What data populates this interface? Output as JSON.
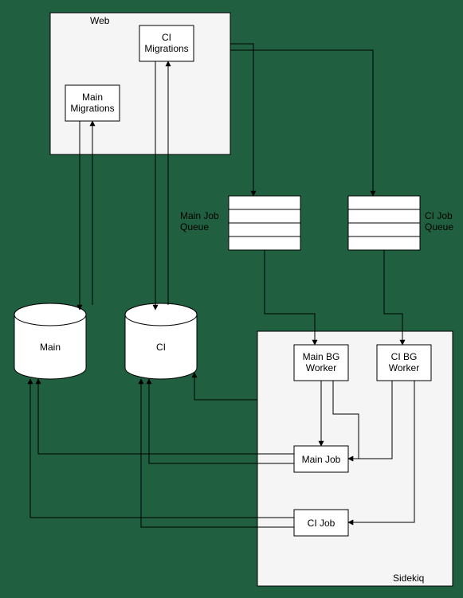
{
  "web": {
    "title": "Web",
    "ci_migrations": "CI\nMigrations",
    "main_migrations": "Main\nMigrations"
  },
  "queues": {
    "main": "Main Job\nQueue",
    "ci": "CI Job\nQueue"
  },
  "dbs": {
    "main": "Main",
    "ci": "CI"
  },
  "sidekiq": {
    "title": "Sidekiq",
    "main_bg_worker": "Main BG\nWorker",
    "ci_bg_worker": "CI BG\nWorker",
    "main_job": "Main Job",
    "ci_job": "CI Job"
  }
}
